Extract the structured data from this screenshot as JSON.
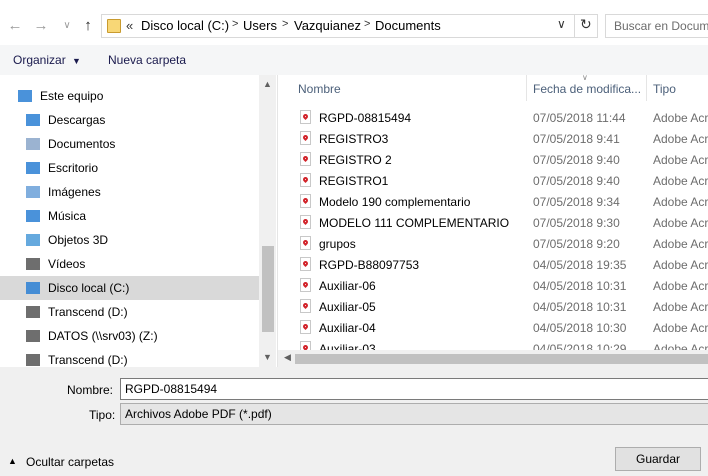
{
  "nav": {
    "back_icon": "arrow-left",
    "forward_icon": "arrow-right",
    "recent_icon": "chevron-down",
    "up_icon": "arrow-up",
    "overflow": "«",
    "breadcrumbs": [
      "Disco local (C:)",
      "Users",
      "Vazquianez",
      "Documents"
    ],
    "separator": ">",
    "refresh_icon": "↻",
    "search_placeholder": "Buscar en Documents"
  },
  "toolbar": {
    "organize_label": "Organizar",
    "new_folder_label": "Nueva carpeta"
  },
  "sidebar": {
    "items": [
      {
        "label": "Este equipo",
        "icon": "computer-icon"
      },
      {
        "label": "Descargas",
        "icon": "download-icon"
      },
      {
        "label": "Documentos",
        "icon": "document-icon"
      },
      {
        "label": "Escritorio",
        "icon": "desktop-icon"
      },
      {
        "label": "Imágenes",
        "icon": "image-icon"
      },
      {
        "label": "Música",
        "icon": "music-icon"
      },
      {
        "label": "Objetos 3D",
        "icon": "cube-icon"
      },
      {
        "label": "Vídeos",
        "icon": "video-icon"
      },
      {
        "label": "Disco local (C:)",
        "icon": "drive-icon",
        "selected": true
      },
      {
        "label": "Transcend (D:)",
        "icon": "usb-drive-icon"
      },
      {
        "label": "DATOS (\\\\srv03) (Z:)",
        "icon": "network-drive-icon"
      },
      {
        "label": "Transcend (D:)",
        "icon": "usb-drive-icon"
      }
    ]
  },
  "filelist": {
    "headers": {
      "name": "Nombre",
      "date": "Fecha de modifica...",
      "type": "Tipo"
    },
    "rows": [
      {
        "name": "RGPD-08815494",
        "date": "07/05/2018 11:44",
        "type": "Adobe Acr"
      },
      {
        "name": "REGISTRO3",
        "date": "07/05/2018 9:41",
        "type": "Adobe Acr"
      },
      {
        "name": "REGISTRO 2",
        "date": "07/05/2018 9:40",
        "type": "Adobe Acr"
      },
      {
        "name": "REGISTRO1",
        "date": "07/05/2018 9:40",
        "type": "Adobe Acr"
      },
      {
        "name": "Modelo 190 complementario",
        "date": "07/05/2018 9:34",
        "type": "Adobe Acr"
      },
      {
        "name": "MODELO 111 COMPLEMENTARIO",
        "date": "07/05/2018 9:30",
        "type": "Adobe Acr"
      },
      {
        "name": "grupos",
        "date": "07/05/2018 9:20",
        "type": "Adobe Acr"
      },
      {
        "name": "RGPD-B88097753",
        "date": "04/05/2018 19:35",
        "type": "Adobe Acr"
      },
      {
        "name": "Auxiliar-06",
        "date": "04/05/2018 10:31",
        "type": "Adobe Acr"
      },
      {
        "name": "Auxiliar-05",
        "date": "04/05/2018 10:31",
        "type": "Adobe Acr"
      },
      {
        "name": "Auxiliar-04",
        "date": "04/05/2018 10:30",
        "type": "Adobe Acr"
      },
      {
        "name": "Auxiliar-03",
        "date": "04/05/2018 10:29",
        "type": "Adobe Acr"
      }
    ]
  },
  "form": {
    "name_label": "Nombre:",
    "name_value": "RGPD-08815494",
    "type_label": "Tipo:",
    "type_value": "Archivos Adobe PDF (*.pdf)"
  },
  "footer": {
    "hide_folders_label": "Ocultar carpetas",
    "save_label": "Guardar"
  }
}
